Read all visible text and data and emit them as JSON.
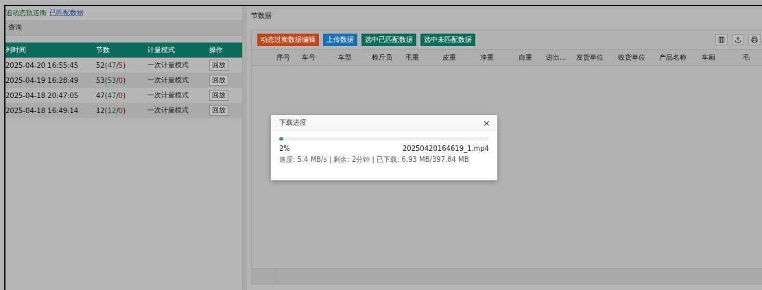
{
  "left_panel": {
    "breadcrumb": {
      "title": "追动态轨道衡",
      "link": "已匹配数据"
    },
    "query_label": "查询",
    "columns": [
      "列时间",
      "节数",
      "计量模式",
      "操作"
    ],
    "rows": [
      {
        "time": "2025-04-20 16:55:45",
        "count": [
          {
            "kind": "total",
            "text": "52("
          },
          {
            "kind": "matched",
            "text": "47"
          },
          {
            "kind": "separator",
            "text": "/"
          },
          {
            "kind": "unmatched",
            "text": "5"
          },
          {
            "kind": "separator",
            "text": ")"
          }
        ],
        "mode": "一次计量模式",
        "action": "回放"
      },
      {
        "time": "2025-04-19 16:28:49",
        "count": [
          {
            "kind": "total",
            "text": "53("
          },
          {
            "kind": "matched",
            "text": "53"
          },
          {
            "kind": "separator",
            "text": "/"
          },
          {
            "kind": "unmatched",
            "text": "0"
          },
          {
            "kind": "separator",
            "text": ")"
          }
        ],
        "mode": "一次计量模式",
        "action": "回放"
      },
      {
        "time": "2025-04-18 20:47:05",
        "count": [
          {
            "kind": "total",
            "text": "47("
          },
          {
            "kind": "matched",
            "text": "47"
          },
          {
            "kind": "separator",
            "text": "/"
          },
          {
            "kind": "unmatched",
            "text": "0"
          },
          {
            "kind": "separator",
            "text": ")"
          }
        ],
        "mode": "一次计量模式",
        "action": "回放"
      },
      {
        "time": "2025-04-18 16:49:14",
        "count": [
          {
            "kind": "total",
            "text": "12("
          },
          {
            "kind": "matched",
            "text": "12"
          },
          {
            "kind": "separator",
            "text": "/"
          },
          {
            "kind": "unmatched",
            "text": "0"
          },
          {
            "kind": "separator",
            "text": ")"
          }
        ],
        "mode": "一次计量模式",
        "action": "回放"
      }
    ]
  },
  "right_panel": {
    "title": "节数据",
    "buttons": [
      {
        "label": "动态过衡数据编辑",
        "color": "#c0461a"
      },
      {
        "label": "上传数据",
        "color": "#1a6fb8"
      },
      {
        "label": "选中已匹配数据",
        "color": "#0c6a5a"
      },
      {
        "label": "选中未匹配数据",
        "color": "#0c6a5a"
      }
    ],
    "columns": [
      "序号",
      "车号",
      "车型",
      "检斤员",
      "毛重",
      "皮重",
      "净重",
      "自重",
      "进出...",
      "发货单位",
      "收货单位",
      "产品名称",
      "车厢",
      "毛"
    ]
  },
  "dialog": {
    "title": "下载进度",
    "close": "×",
    "level": 0.02,
    "percent": "2%",
    "file": "20250420164619_1.mp4",
    "details": "速度: 5.4 MB/s | 剩余: 2分钟 | 已下载: 6.93 MB/397.84 MB"
  }
}
